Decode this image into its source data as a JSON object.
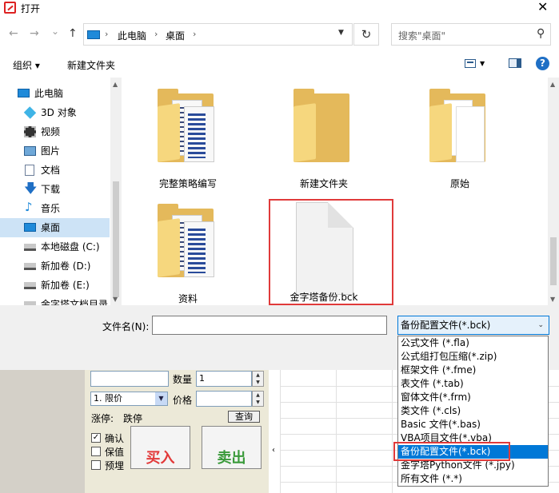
{
  "window": {
    "title": "打开",
    "close_glyph": "✕"
  },
  "nav": {
    "back_glyph": "←",
    "forward_glyph": "→",
    "recent_glyph": "⌄",
    "up_glyph": "↑",
    "breadcrumb": [
      "此电脑",
      "桌面"
    ],
    "separator": "›",
    "refresh_glyph": "↻",
    "search_placeholder": "搜索\"桌面\"",
    "search_glyph": "⚲"
  },
  "toolbar": {
    "organize": "组织 ▾",
    "new_folder": "新建文件夹",
    "help_glyph": "?"
  },
  "sidebar": {
    "items": [
      {
        "label": "此电脑",
        "icon": "pc-icon"
      },
      {
        "label": "3D 对象",
        "icon": "cube-icon"
      },
      {
        "label": "视频",
        "icon": "video-icon"
      },
      {
        "label": "图片",
        "icon": "picture-icon"
      },
      {
        "label": "文档",
        "icon": "document-icon"
      },
      {
        "label": "下载",
        "icon": "download-icon"
      },
      {
        "label": "音乐",
        "icon": "music-icon"
      },
      {
        "label": "桌面",
        "icon": "desktop-icon",
        "selected": true
      },
      {
        "label": "本地磁盘 (C:)",
        "icon": "drive-icon"
      },
      {
        "label": "新加卷 (D:)",
        "icon": "drive-icon"
      },
      {
        "label": "新加卷 (E:)",
        "icon": "drive-icon"
      },
      {
        "label": "金字塔文档目录",
        "icon": "drive-icon"
      }
    ]
  },
  "files": [
    {
      "name": "完整策略编写",
      "type": "folder-with-docs"
    },
    {
      "name": "新建文件夹",
      "type": "folder"
    },
    {
      "name": "原始",
      "type": "folder-with-white-docs"
    },
    {
      "name": "资料",
      "type": "folder-with-docs"
    },
    {
      "name": "金字塔备份.bck",
      "type": "file"
    }
  ],
  "bottom": {
    "filename_label": "文件名(N):",
    "filename_value": "",
    "filetype_selected": "备份配置文件(*.bck)",
    "filetype_options": [
      "公式文件 (*.fla)",
      "公式组打包压缩(*.zip)",
      "框架文件 (*.fme)",
      "表文件 (*.tab)",
      "窗体文件(*.frm)",
      "类文件 (*.cls)",
      "Basic 文件(*.bas)",
      "VBA项目文件(*.vba)",
      "备份配置文件(*.bck)",
      "金字塔Python文件 (*.jpy)",
      "所有文件 (*.*)"
    ],
    "selected_index": 8
  },
  "background_app": {
    "quantity_label": "数量",
    "quantity_value": "1",
    "order_type": "1. 限价",
    "price_label": "价格",
    "price_value": "",
    "limit_label": "涨停:",
    "limit_value": "跌停",
    "query_button": "查询",
    "checkboxes": [
      {
        "label": "确认",
        "checked": true
      },
      {
        "label": "保值",
        "checked": false
      },
      {
        "label": "预埋",
        "checked": false
      }
    ],
    "buy_label": "买入",
    "sell_label": "卖出"
  },
  "colors": {
    "accent": "#0078d7",
    "highlight_red": "#e03a3a",
    "selected_side": "#cde3f6"
  }
}
